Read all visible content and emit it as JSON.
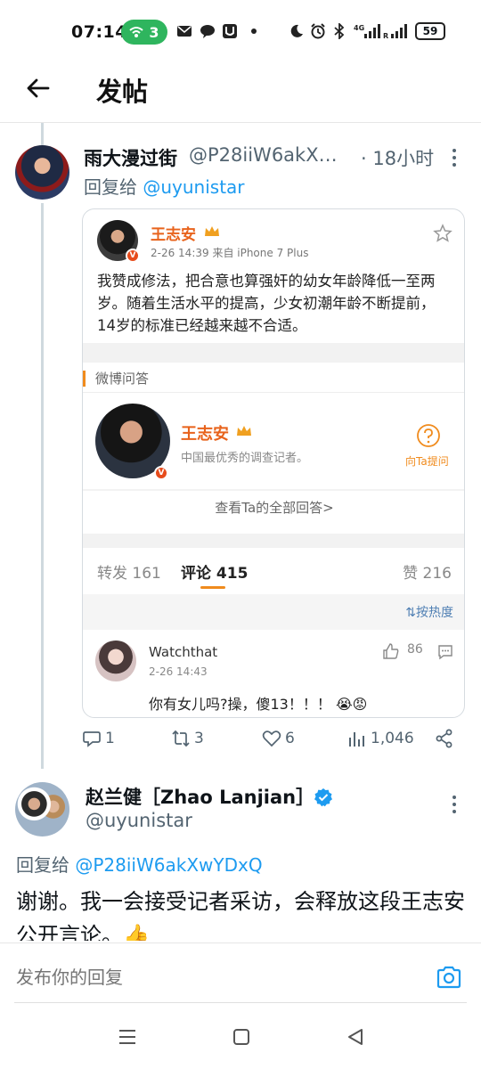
{
  "status_bar": {
    "time": "07:14",
    "hotspot_count": "3",
    "battery": "59",
    "network": "4G"
  },
  "header": {
    "title": "发帖"
  },
  "post1": {
    "display_name": "雨大漫过街",
    "handle": "@P28iiW6akXwYDxQ",
    "time": "· 18小时",
    "reply_prefix": "回复给 ",
    "reply_to": "@uyunistar",
    "image": {
      "author": "王志安",
      "meta": "2-26 14:39  来自 iPhone 7 Plus",
      "text": "我赞成修法，把合意也算强奸的幼女年龄降低一至两岁。随着生活水平的提高，少女初潮年龄不断提前，14岁的标准已经越来越不合适。",
      "qa_section": "微博问答",
      "qa_name": "王志安",
      "qa_desc": "中国最优秀的调查记者。",
      "ask_label": "向Ta提问",
      "view_all": "查看Ta的全部回答>",
      "tab_repost": "转发 161",
      "tab_comment": "评论 415",
      "tab_like": "赞 216",
      "sort": "按热度",
      "comment_user": "Watchthat",
      "comment_time": "2-26 14:43",
      "comment_likes": "86",
      "comment_text": "你有女儿吗?操，傻13！！！"
    },
    "actions": {
      "replies": "1",
      "reposts": "3",
      "likes": "6",
      "views": "1,046"
    }
  },
  "post2": {
    "display_name": "赵兰健［Zhao Lanjian］",
    "handle": "@uyunistar",
    "reply_prefix": "回复给 ",
    "reply_to": "@P28iiW6akXwYDxQ",
    "text": "谢谢。我一会接受记者采访，会释放这段王志安公开言论。👍"
  },
  "composer": {
    "placeholder": "发布你的回复"
  },
  "colors": {
    "accent": "#1d9bf0",
    "weibo_orange": "#e8631c",
    "secondary_text": "#536471"
  }
}
